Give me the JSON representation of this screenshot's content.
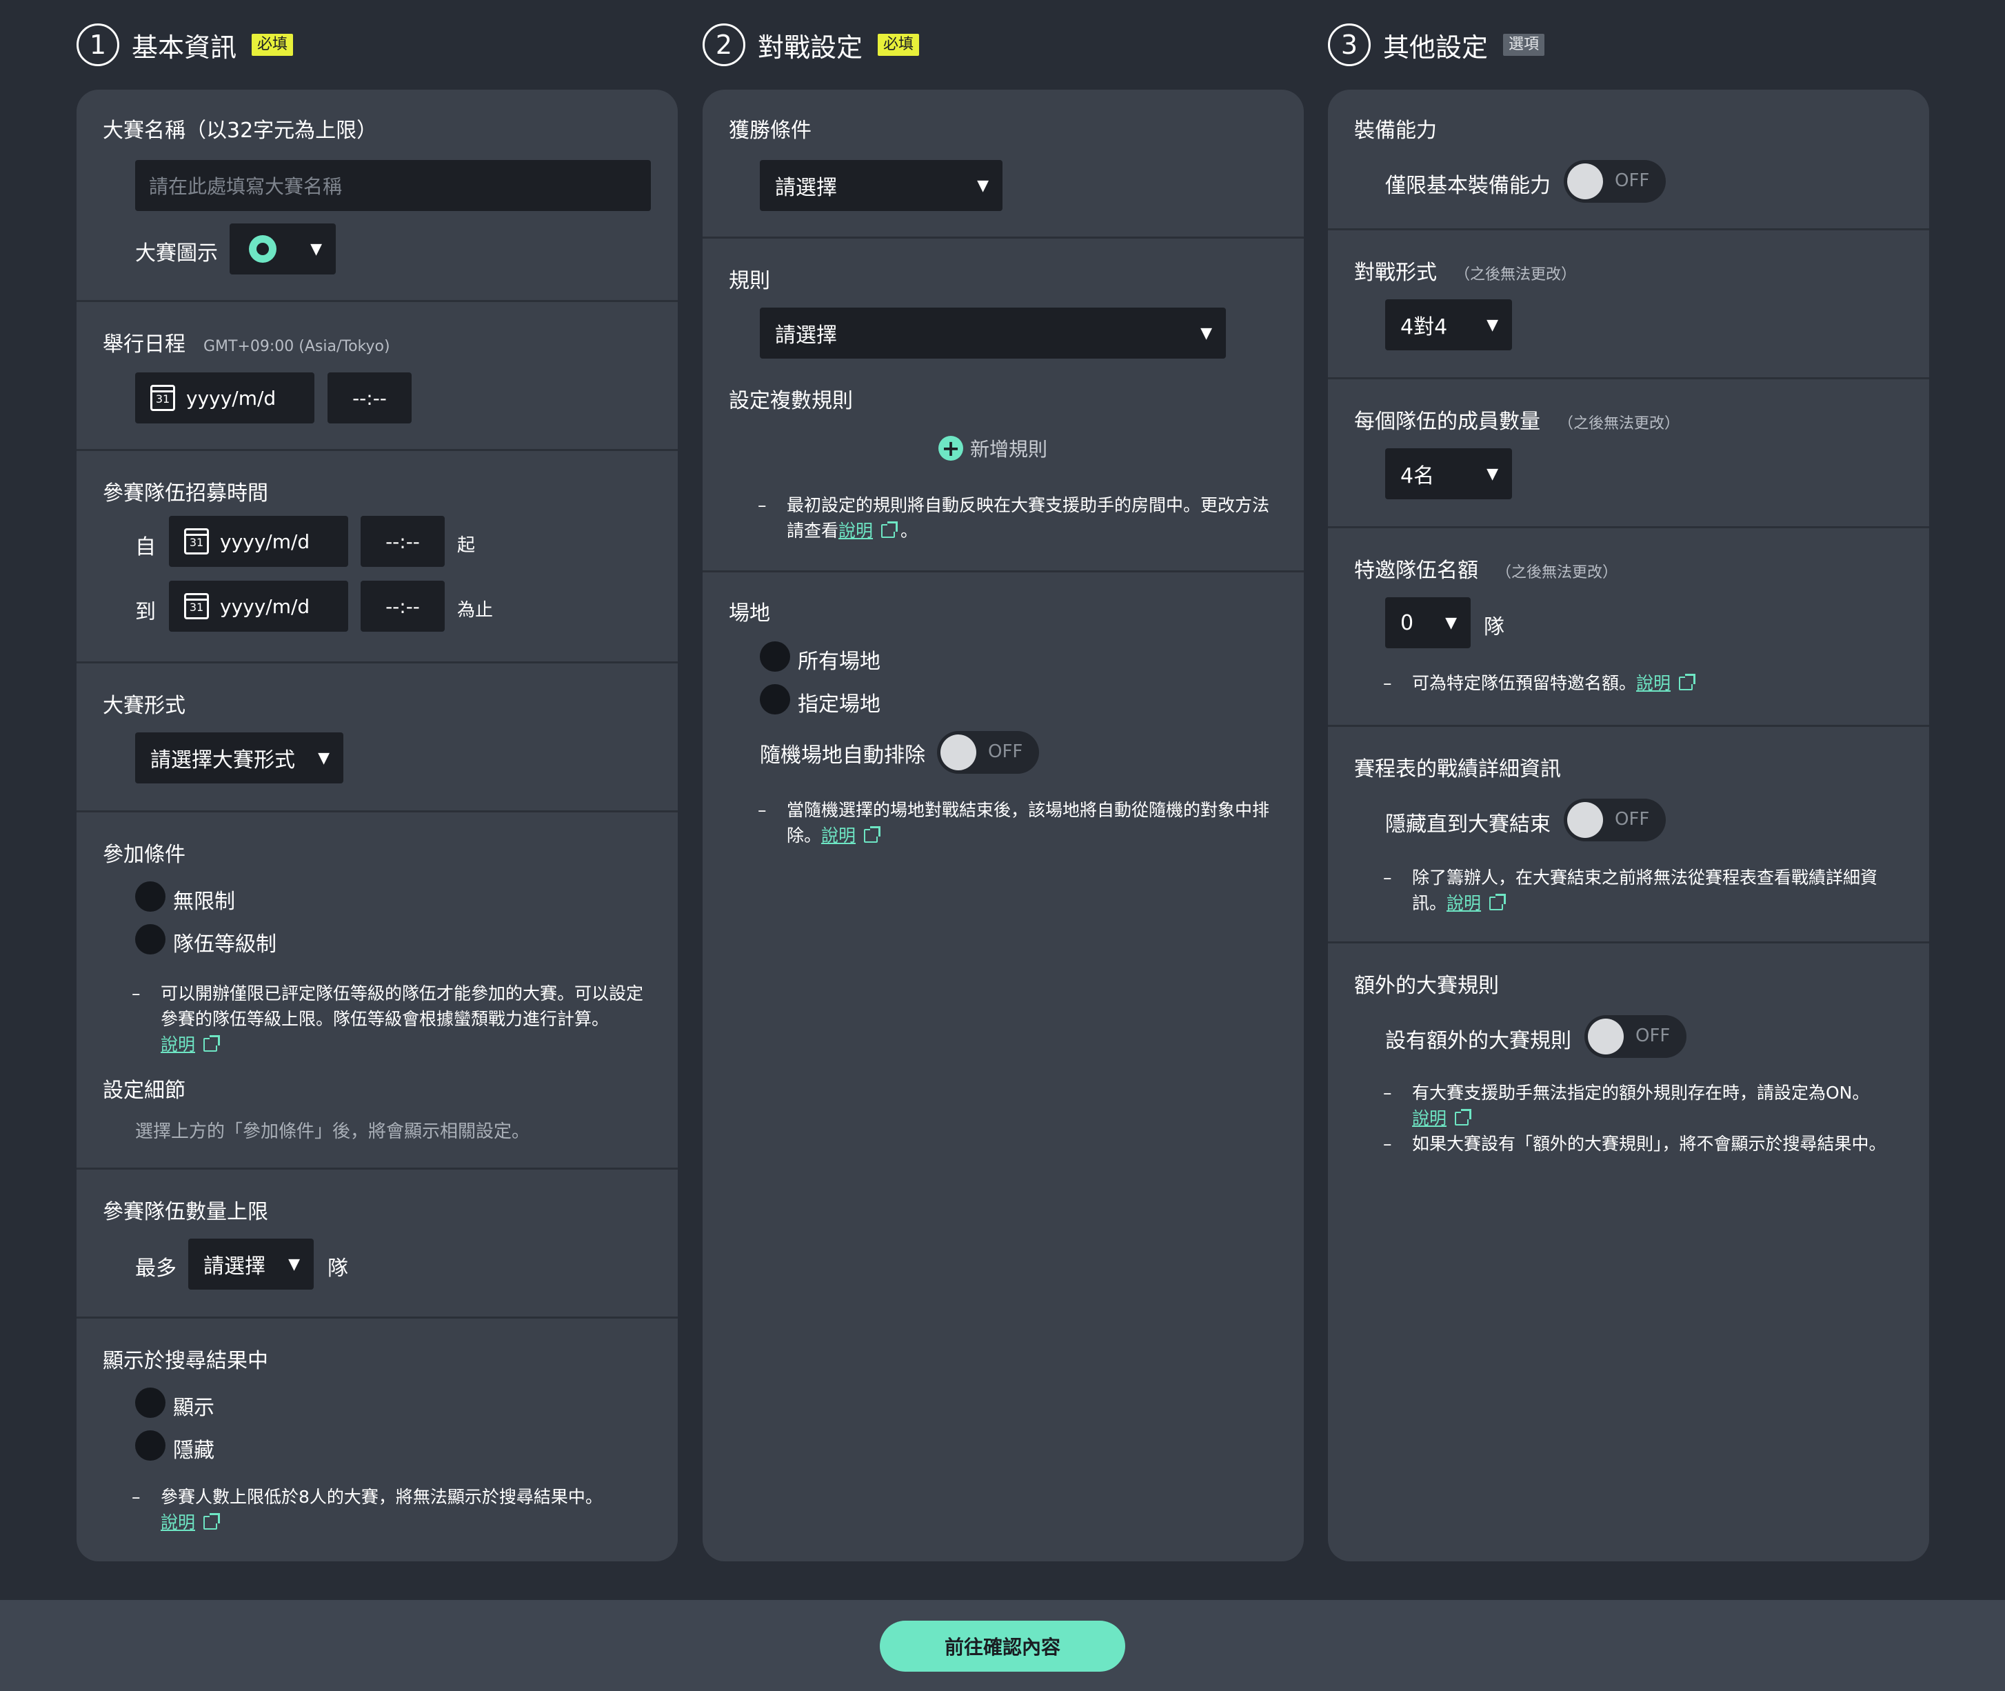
{
  "columns": [
    {
      "number": "1",
      "title": "基本資訊",
      "badge": "必填"
    },
    {
      "number": "2",
      "title": "對戰設定",
      "badge": "必填"
    },
    {
      "number": "3",
      "title": "其他設定",
      "badge": "選項"
    }
  ],
  "basic": {
    "name_label": "大賽名稱（以32字元為上限）",
    "name_placeholder": "請在此處填寫大賽名稱",
    "icon_label": "大賽圖示",
    "schedule_label": "舉行日程",
    "timezone": "GMT+09:00 (Asia/Tokyo)",
    "date_placeholder": "yyyy/m/d",
    "time_placeholder": "--:--",
    "calendar_day": "31",
    "recruit_label": "參賽隊伍招募時間",
    "from_label": "自",
    "to_label": "到",
    "start_suffix": "起",
    "end_suffix": "為止",
    "format_label": "大賽形式",
    "format_select": "請選擇大賽形式",
    "entry_label": "參加條件",
    "entry_options": [
      "無限制",
      "隊伍等級制"
    ],
    "entry_note": "可以開辦僅限已評定隊伍等級的隊伍才能參加的大賽。可以設定參賽的隊伍等級上限。隊伍等級會根據蠻頹戰力進行計算。",
    "help_link": "說明",
    "detail_label": "設定細節",
    "detail_text": "選擇上方的「參加條件」後，將會顯示相關設定。",
    "max_teams_label": "參賽隊伍數量上限",
    "max_prefix": "最多",
    "max_select": "請選擇",
    "team_unit": "隊",
    "visibility_label": "顯示於搜尋結果中",
    "visibility_options": [
      "顯示",
      "隱藏"
    ],
    "visibility_note": "參賽人數上限低於8人的大賽，將無法顯示於搜尋結果中。"
  },
  "battle": {
    "win_label": "獲勝條件",
    "win_select": "請選擇",
    "rule_label": "規則",
    "rule_select": "請選擇",
    "multi_rule_label": "設定複數規則",
    "add_rule": "新增規則",
    "rule_note": "最初設定的規則將自動反映在大賽支援助手的房間中。更改方法請查看",
    "help_link": "說明",
    "stage_label": "場地",
    "stage_options": [
      "所有場地",
      "指定場地"
    ],
    "random_exclude_label": "隨機場地自動排除",
    "toggle_off": "OFF",
    "stage_note": "當隨機選擇的場地對戰結束後，該場地將自動從隨機的對象中排除。"
  },
  "other": {
    "gear_label": "裝備能力",
    "gear_toggle_label": "僅限基本裝備能力",
    "toggle_off": "OFF",
    "format_label": "對戰形式",
    "unchangeable": "（之後無法更改）",
    "format_select": "4對4",
    "members_label": "每個隊伍的成員數量",
    "members_select": "4名",
    "invite_label": "特邀隊伍名額",
    "invite_select": "0",
    "team_unit": "隊",
    "invite_note": "可為特定隊伍預留特邀名額。",
    "help_link": "說明",
    "results_label": "賽程表的戰績詳細資訊",
    "results_toggle_label": "隱藏直到大賽結束",
    "results_note": "除了籌辦人，在大賽結束之前將無法從賽程表查看戰績詳細資訊。",
    "extra_label": "額外的大賽規則",
    "extra_toggle_label": "設有額外的大賽規則",
    "extra_note_1": "有大賽支援助手無法指定的額外規則存在時，請設定為ON。",
    "extra_note_2": "如果大賽設有「額外的大賽規則」，將不會顯示於搜尋結果中。"
  },
  "footer": {
    "confirm_button": "前往確認內容"
  },
  "colors": {
    "accent": "#6ee6c4",
    "required_badge": "#e8f03a",
    "card": "#3b414b",
    "background": "#282d36"
  }
}
